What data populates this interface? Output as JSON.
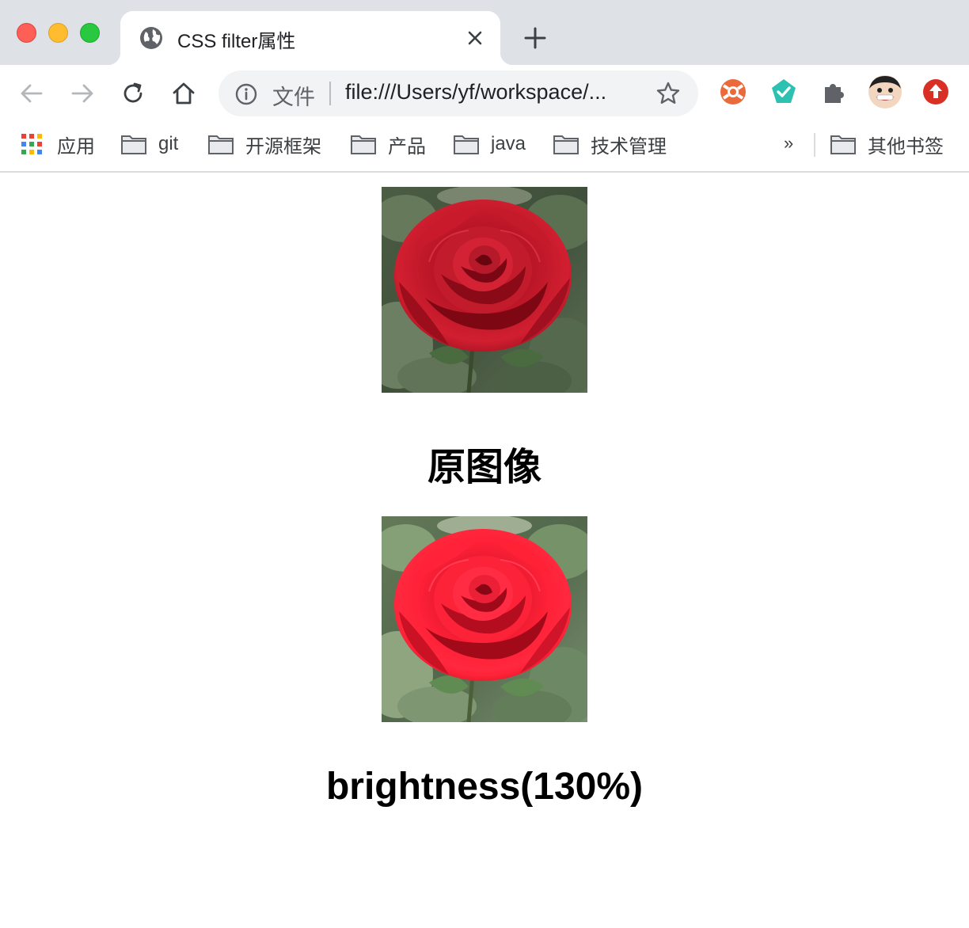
{
  "window": {
    "controls": [
      "close",
      "minimize",
      "zoom"
    ]
  },
  "tab": {
    "title": "CSS filter属性",
    "favicon": "globe-icon",
    "close_icon": "close-icon"
  },
  "toolbar": {
    "back_icon": "arrow-back-icon",
    "forward_icon": "arrow-forward-icon",
    "reload_icon": "reload-icon",
    "home_icon": "home-icon",
    "omnibox": {
      "info_icon": "info-icon",
      "scheme_label": "文件",
      "url": "file:///Users/yf/workspace/...",
      "star_icon": "star-icon"
    },
    "extensions": [
      "lifebuoy-extension-icon",
      "shield-check-extension-icon",
      "puzzle-extensions-icon",
      "avatar",
      "upload-extension-icon"
    ]
  },
  "bookmarks": {
    "items": [
      {
        "label": "应用",
        "icon": "apps-grid-icon"
      },
      {
        "label": "git",
        "icon": "folder-icon"
      },
      {
        "label": "开源框架",
        "icon": "folder-icon"
      },
      {
        "label": "产品",
        "icon": "folder-icon"
      },
      {
        "label": "java",
        "icon": "folder-icon"
      },
      {
        "label": "技术管理",
        "icon": "folder-icon"
      }
    ],
    "overflow": "»",
    "other": {
      "label": "其他书签",
      "icon": "folder-icon"
    }
  },
  "page": {
    "captions": [
      "原图像",
      "brightness(130%)"
    ]
  },
  "colors": {
    "tabstrip": "#dee1e6",
    "omnibox": "#f1f3f4",
    "close": "#fe5f57",
    "minimize": "#febc2e",
    "zoom": "#28c840"
  }
}
